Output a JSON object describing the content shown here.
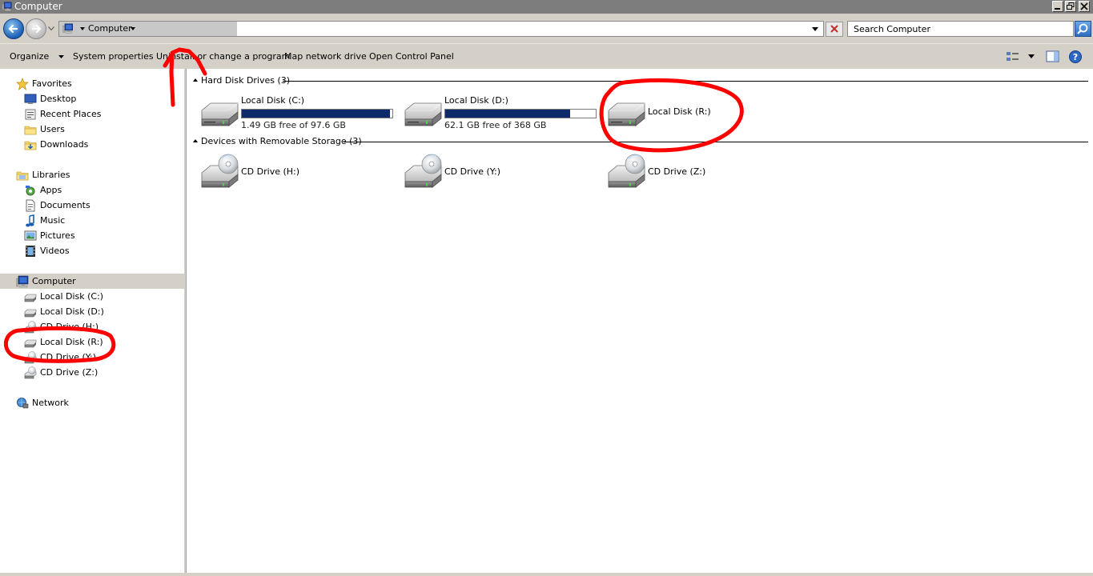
{
  "window": {
    "title": "Computer"
  },
  "address": {
    "crumb": "Computer"
  },
  "search": {
    "placeholder": "Search Computer"
  },
  "toolbar": {
    "organize": "Organize",
    "system_properties": "System properties",
    "uninstall": "Uninstall or change a program",
    "map_drive": "Map network drive",
    "control_panel": "Open Control Panel"
  },
  "sidebar": {
    "favorites": "Favorites",
    "desktop": "Desktop",
    "recent": "Recent Places",
    "users": "Users",
    "downloads": "Downloads",
    "libraries": "Libraries",
    "apps": "Apps",
    "documents": "Documents",
    "music": "Music",
    "pictures": "Pictures",
    "videos": "Videos",
    "computer": "Computer",
    "disk_c": "Local Disk (C:)",
    "disk_d": "Local Disk (D:)",
    "cd_h": "CD Drive (H:)",
    "disk_r": "Local Disk (R:)",
    "cd_y": "CD Drive (Y:)",
    "cd_z": "CD Drive (Z:)",
    "network": "Network"
  },
  "main": {
    "hdd_header": "Hard Disk Drives (3)",
    "removable_header": "Devices with Removable Storage (3)",
    "drives": [
      {
        "name": "Local Disk (C:)",
        "free": "1.49 GB free of 97.6 GB",
        "used_fraction": 0.985
      },
      {
        "name": "Local Disk (D:)",
        "free": "62.1 GB free of 368 GB",
        "used_fraction": 0.83
      },
      {
        "name": "Local Disk (R:)"
      }
    ],
    "removable": [
      {
        "name": "CD Drive (H:)"
      },
      {
        "name": "CD Drive (Y:)"
      },
      {
        "name": "CD Drive (Z:)"
      }
    ]
  },
  "colors": {
    "chrome": "#d4d0c8",
    "titlebar": "#7d7d7d",
    "capacity_bar": "#0e2a6b",
    "annotation": "#ff0000"
  }
}
